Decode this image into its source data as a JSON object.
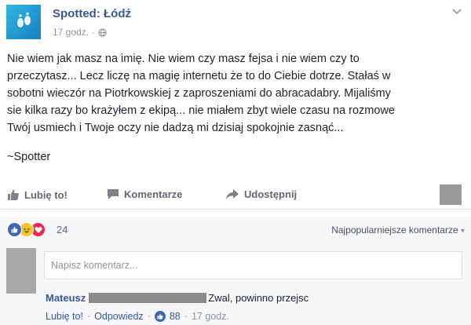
{
  "post": {
    "page_name": "Spotted: Łódź",
    "time": "17 godz.",
    "separator": "·",
    "caret_icon": "chevron-down-icon",
    "body_lines": [
      "Nie wiem jak masz na imię. Nie wiem czy masz fejsa i nie wiem czy to",
      "przeczytasz... Lecz liczę na magię internetu że to do Ciebie dotrze. Stałaś w",
      "sobotni wieczór na Piotrkowskiej z zaproszeniami do abracadabry. Mijaliśmy",
      "sie kilka razy bo krażyłem z ekipą... nie miałem zbyt wiele czasu na rozmowe",
      "Twój usmiech i Twoje oczy nie dadzą mi dzisiaj spokojnie zasnąć..."
    ],
    "signature": "~Spotter"
  },
  "actions": {
    "like": "Lubię to!",
    "comment": "Komentarze",
    "share": "Udostępnij"
  },
  "reactions": {
    "count": "24",
    "sort_label": "Najpopularniejsze komentarze",
    "sort_caret": "▾"
  },
  "composer": {
    "placeholder": "Napisz komentarz..."
  },
  "comment": {
    "author": "Mateusz",
    "text": "Zwal, powinno przejsc",
    "like_label": "Lubię to!",
    "reply_label": "Odpowiedz",
    "separator": "·",
    "like_count": "88",
    "time": "17 godz."
  },
  "colors": {
    "link": "#365899",
    "muted": "#90949c",
    "like_blue": "#4267b2",
    "love_red": "#f0284a",
    "haha_yellow": "#f7c531"
  }
}
